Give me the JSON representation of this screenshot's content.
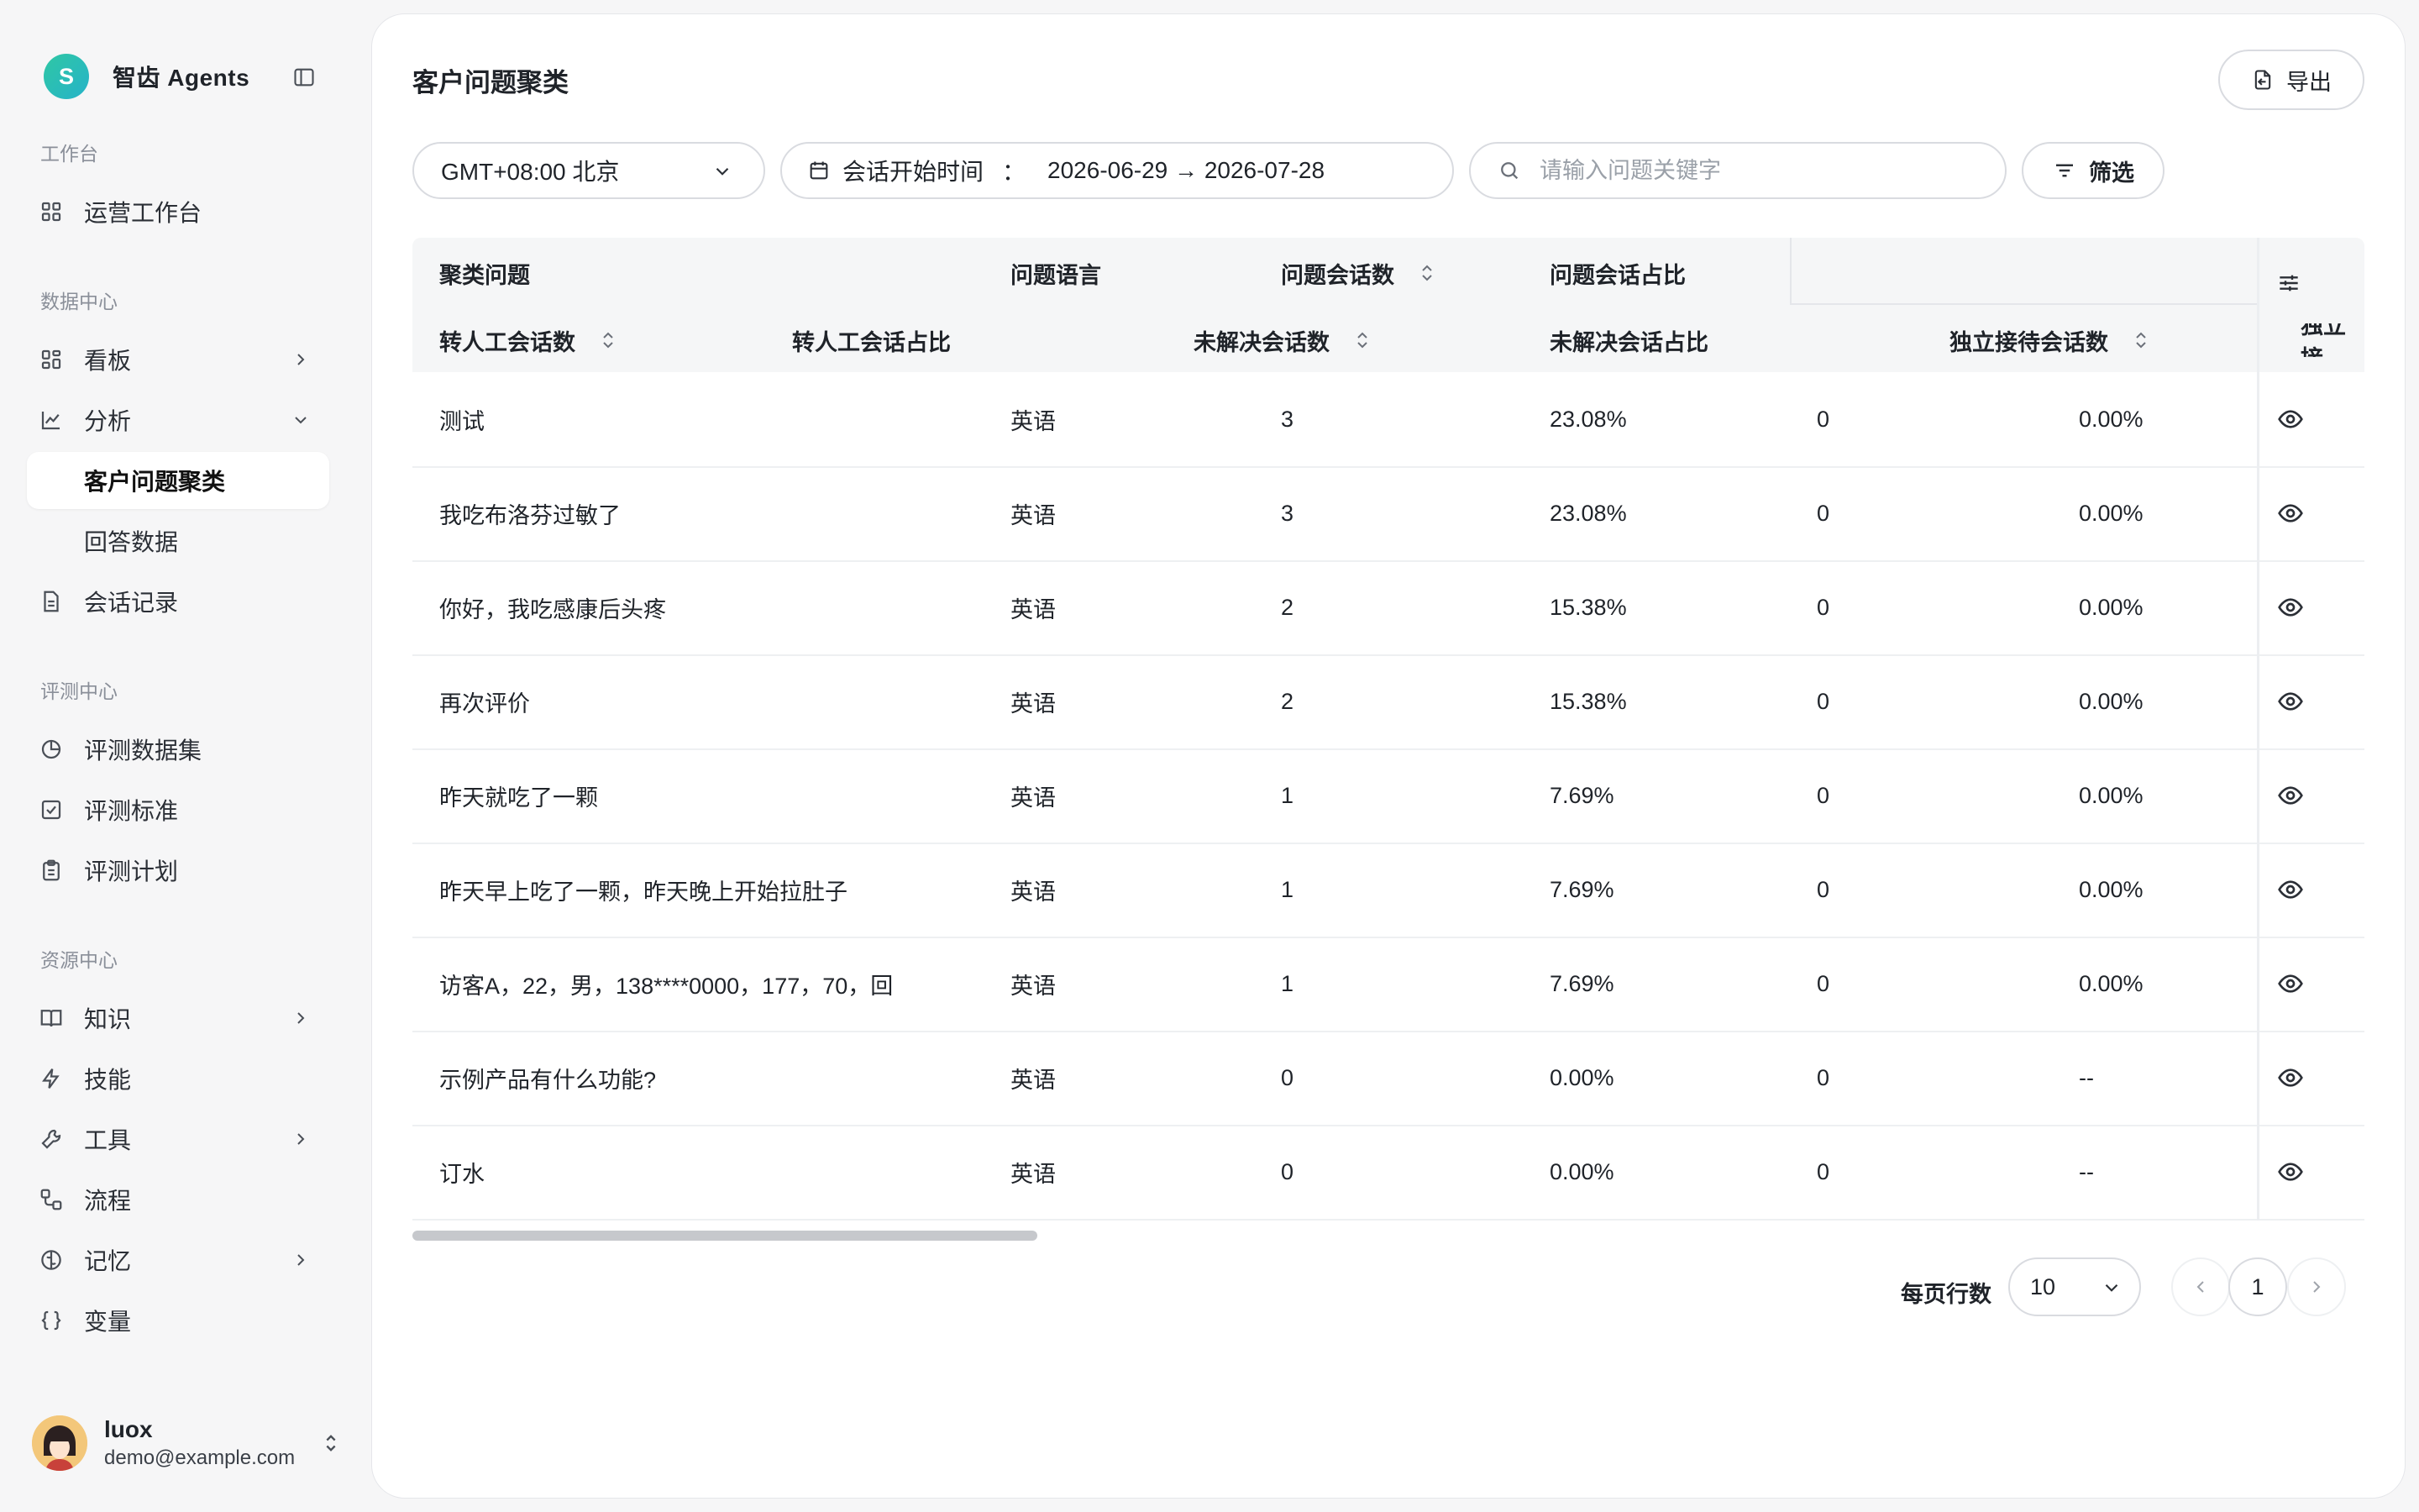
{
  "app": {
    "brand_initial": "S",
    "brand_name": "智齿 Agents"
  },
  "sidebar": {
    "sections": [
      {
        "title": "工作台"
      },
      {
        "title": "数据中心"
      },
      {
        "title": "评测中心"
      },
      {
        "title": "资源中心"
      }
    ],
    "items": [
      {
        "label": "运营工作台",
        "icon": "grid-icon"
      },
      {
        "label": "看板",
        "icon": "dashboard-icon"
      },
      {
        "label": "分析",
        "icon": "chart-icon"
      },
      {
        "label": "客户问题聚类",
        "active": true
      },
      {
        "label": "回答数据"
      },
      {
        "label": "会话记录",
        "icon": "document-icon"
      },
      {
        "label": "评测数据集",
        "icon": "pie-icon"
      },
      {
        "label": "评测标准",
        "icon": "checkbox-icon"
      },
      {
        "label": "评测计划",
        "icon": "clipboard-icon"
      },
      {
        "label": "知识",
        "icon": "book-icon"
      },
      {
        "label": "技能",
        "icon": "lightning-icon"
      },
      {
        "label": "工具",
        "icon": "wrench-icon"
      },
      {
        "label": "流程",
        "icon": "flow-icon"
      },
      {
        "label": "记忆",
        "icon": "brain-icon"
      },
      {
        "label": "变量",
        "icon": "braces-icon"
      }
    ],
    "user": {
      "name": "luox",
      "email": "demo@example.com"
    }
  },
  "page": {
    "title": "客户问题聚类",
    "export_label": "导出",
    "timezone": "GMT+08:00 北京",
    "date_label": "会话开始时间",
    "date_colon": "：",
    "date_range": "2026-06-29 → 2026-07-28",
    "search_placeholder": "请输入问题关键字",
    "filter_label": "筛选"
  },
  "table": {
    "header_row1": [
      "聚类问题",
      "问题语言",
      "问题会话数",
      "问题会话占比"
    ],
    "header_row2": [
      "转人工会话数",
      "转人工会话占比",
      "未解决会话数",
      "未解决会话占比",
      "独立接待会话数",
      "独立接"
    ],
    "rows": [
      {
        "question": "测试",
        "lang": "英语",
        "count": "3",
        "ratio": "23.08%",
        "handoff": "0",
        "handoff_ratio": "0.00%"
      },
      {
        "question": "我吃布洛芬过敏了",
        "lang": "英语",
        "count": "3",
        "ratio": "23.08%",
        "handoff": "0",
        "handoff_ratio": "0.00%"
      },
      {
        "question": "你好，我吃感康后头疼",
        "lang": "英语",
        "count": "2",
        "ratio": "15.38%",
        "handoff": "0",
        "handoff_ratio": "0.00%"
      },
      {
        "question": "再次评价",
        "lang": "英语",
        "count": "2",
        "ratio": "15.38%",
        "handoff": "0",
        "handoff_ratio": "0.00%"
      },
      {
        "question": "昨天就吃了一颗",
        "lang": "英语",
        "count": "1",
        "ratio": "7.69%",
        "handoff": "0",
        "handoff_ratio": "0.00%"
      },
      {
        "question": "昨天早上吃了一颗，昨天晚上开始拉肚子",
        "lang": "英语",
        "count": "1",
        "ratio": "7.69%",
        "handoff": "0",
        "handoff_ratio": "0.00%"
      },
      {
        "question": "访客A，22，男，138****0000，177，70，回",
        "lang": "英语",
        "count": "1",
        "ratio": "7.69%",
        "handoff": "0",
        "handoff_ratio": "0.00%"
      },
      {
        "question": "示例产品有什么功能?",
        "lang": "英语",
        "count": "0",
        "ratio": "0.00%",
        "handoff": "0",
        "handoff_ratio": "--"
      },
      {
        "question": "订水",
        "lang": "英语",
        "count": "0",
        "ratio": "0.00%",
        "handoff": "0",
        "handoff_ratio": "--"
      }
    ],
    "scroll_fraction": 0.32
  },
  "pagination": {
    "rows_label": "每页行数",
    "rows_value": "10",
    "current_page": "1"
  },
  "colors": {
    "brand": "#2fc7a4",
    "border": "#d9dbe0",
    "header_bg": "#f5f6f7"
  }
}
